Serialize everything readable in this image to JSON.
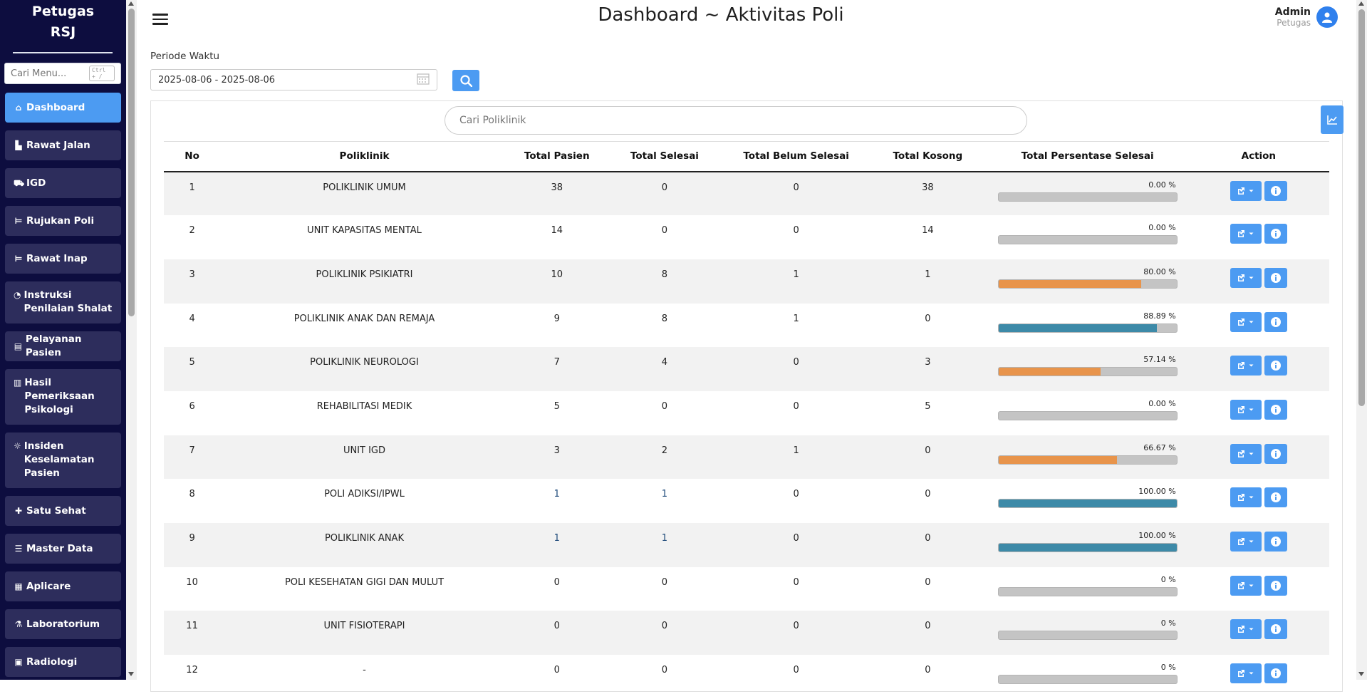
{
  "sidebar": {
    "brand": "Petugas\nRSJ",
    "search_placeholder": "Cari Menu...",
    "search_shortcut": "Ctrl + /",
    "items": [
      {
        "label": "Dashboard",
        "icon": "home-icon",
        "active": true
      },
      {
        "label": "Rawat Jalan",
        "icon": "hospital-user-icon"
      },
      {
        "label": "IGD",
        "icon": "ambulance-icon"
      },
      {
        "label": "Rujukan Poli",
        "icon": "bed-icon"
      },
      {
        "label": "Rawat Inap",
        "icon": "bed-icon"
      },
      {
        "label": "Instruksi Penilaian Shalat",
        "icon": "clock-icon"
      },
      {
        "label": "Pelayanan Pasien",
        "icon": "id-card-icon"
      },
      {
        "label": "Hasil Pemeriksaan Psikologi",
        "icon": "file-icon"
      },
      {
        "label": "Insiden Keselamatan Pasien",
        "icon": "alarm-icon"
      },
      {
        "label": "Satu Sehat",
        "icon": "puzzle-icon"
      },
      {
        "label": "Master Data",
        "icon": "database-icon"
      },
      {
        "label": "Aplicare",
        "icon": "building-icon"
      },
      {
        "label": "Laboratorium",
        "icon": "flask-icon"
      },
      {
        "label": "Radiologi",
        "icon": "radiology-icon"
      }
    ]
  },
  "header": {
    "title": "Dashboard ~ Aktivitas Poli",
    "user_name": "Admin",
    "user_role": "Petugas"
  },
  "filter": {
    "period_label": "Periode Waktu",
    "period_value": "2025-08-06 - 2025-08-06"
  },
  "panel": {
    "search_placeholder": "Cari Poliklinik"
  },
  "table": {
    "headers": [
      "No",
      "Poliklinik",
      "Total Pasien",
      "Total Selesai",
      "Total Belum Selesai",
      "Total Kosong",
      "Total Persentase Selesai",
      "Action"
    ],
    "rows": [
      {
        "no": "1",
        "poli": "POLIKLINIK UMUM",
        "pasien": "38",
        "selesai": "0",
        "belum": "0",
        "kosong": "38",
        "pct_text": "0.00 %",
        "pct": 0,
        "color": "#9e9e9e"
      },
      {
        "no": "2",
        "poli": "UNIT KAPASITAS MENTAL",
        "pasien": "14",
        "selesai": "0",
        "belum": "0",
        "kosong": "14",
        "pct_text": "0.00 %",
        "pct": 0,
        "color": "#9e9e9e"
      },
      {
        "no": "3",
        "poli": "POLIKLINIK PSIKIATRI",
        "pasien": "10",
        "selesai": "8",
        "belum": "1",
        "kosong": "1",
        "pct_text": "80.00 %",
        "pct": 80,
        "color": "#e8944b"
      },
      {
        "no": "4",
        "poli": "POLIKLINIK ANAK DAN REMAJA",
        "pasien": "9",
        "selesai": "8",
        "belum": "1",
        "kosong": "0",
        "pct_text": "88.89 %",
        "pct": 88.89,
        "color": "#3d8aa8"
      },
      {
        "no": "5",
        "poli": "POLIKLINIK NEUROLOGI",
        "pasien": "7",
        "selesai": "4",
        "belum": "0",
        "kosong": "3",
        "pct_text": "57.14 %",
        "pct": 57.14,
        "color": "#e8944b"
      },
      {
        "no": "6",
        "poli": "REHABILITASI MEDIK",
        "pasien": "5",
        "selesai": "0",
        "belum": "0",
        "kosong": "5",
        "pct_text": "0.00 %",
        "pct": 0,
        "color": "#9e9e9e"
      },
      {
        "no": "7",
        "poli": "UNIT IGD",
        "pasien": "3",
        "selesai": "2",
        "belum": "1",
        "kosong": "0",
        "pct_text": "66.67 %",
        "pct": 66.67,
        "color": "#e8944b"
      },
      {
        "no": "8",
        "poli": "POLI ADIKSI/IPWL",
        "pasien": "1",
        "selesai": "1",
        "belum": "0",
        "kosong": "0",
        "pct_text": "100.00 %",
        "pct": 100,
        "color": "#3d8aa8"
      },
      {
        "no": "9",
        "poli": "POLIKLINIK ANAK",
        "pasien": "1",
        "selesai": "1",
        "belum": "0",
        "kosong": "0",
        "pct_text": "100.00 %",
        "pct": 100,
        "color": "#3d8aa8"
      },
      {
        "no": "10",
        "poli": "POLI KESEHATAN GIGI DAN MULUT",
        "pasien": "0",
        "selesai": "0",
        "belum": "0",
        "kosong": "0",
        "pct_text": "0 %",
        "pct": 0,
        "color": "#9e9e9e"
      },
      {
        "no": "11",
        "poli": "UNIT FISIOTERAPI",
        "pasien": "0",
        "selesai": "0",
        "belum": "0",
        "kosong": "0",
        "pct_text": "0 %",
        "pct": 0,
        "color": "#9e9e9e"
      },
      {
        "no": "12",
        "poli": "-",
        "pasien": "0",
        "selesai": "0",
        "belum": "0",
        "kosong": "0",
        "pct_text": "0 %",
        "pct": 0,
        "color": "#9e9e9e"
      }
    ]
  },
  "colors": {
    "sidebar_bg": "#0d0d3f",
    "sidebar_item_bg": "#2d2d5c",
    "accent": "#4c9bf2",
    "bar_orange": "#e8944b",
    "bar_blue": "#3d8aa8",
    "bar_empty": "#c4c4c4"
  }
}
